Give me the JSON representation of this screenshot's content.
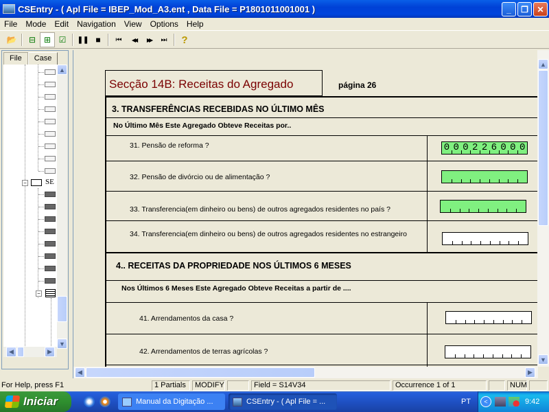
{
  "window": {
    "title": "CSEntry - ( Apl File = IBEP_Mod_A3.ent , Data File = P1801011001001 )",
    "controls": [
      "minimize",
      "restore",
      "close"
    ]
  },
  "menu": [
    "File",
    "Mode",
    "Edit",
    "Navigation",
    "View",
    "Options",
    "Help"
  ],
  "toolbar": {
    "icons": [
      "open-folder-icon",
      "add-case-icon",
      "insert-node-icon",
      "verify-icon",
      "pause-icon",
      "stop-icon",
      "first-icon",
      "previous-icon",
      "next-icon",
      "last-icon",
      "help-icon"
    ],
    "glyphs": [
      "📂",
      "⊟",
      "⊞",
      "☑",
      "❚❚",
      "■",
      "⏮",
      "◀◀",
      "▶▶",
      "⏭",
      "?"
    ]
  },
  "tree": {
    "tabs": [
      "File",
      "Case"
    ],
    "active_tab": "Case",
    "node_label": "SE"
  },
  "form": {
    "title": "Secção 14B:  Receitas do Agregado",
    "page_label": "página 26",
    "sections": [
      {
        "heading": "3. TRANSFERÊNCIAS RECEBIDAS NO ÚLTIMO MÊS",
        "subheading": "No Último Mês  Este Agregado Obteve Receitas por..",
        "questions": [
          {
            "label": "31. Pensão de reforma ?",
            "value": "000226000",
            "state": "filled"
          },
          {
            "label": "32. Pensão de divórcio ou de alimentação ?",
            "value": "",
            "state": "filled"
          },
          {
            "label": "33. Transferencia(em dinheiro ou bens) de outros agregados residentes no país ?",
            "value": "",
            "state": "current"
          },
          {
            "label": "34. Transferencia(em dinheiro ou bens) de outros agregados residentes no estrangeiro",
            "value": "",
            "state": "empty"
          }
        ]
      },
      {
        "heading": "4.. RECEITAS DA PROPRIEDADE NOS ÚLTIMOS 6 MESES",
        "subheading": "Nos Últimos 6 Meses  Este Agregado Obteve Receitas a partir de ....",
        "questions": [
          {
            "label": "41. Arrendamentos da casa ?",
            "value": "",
            "state": "empty"
          },
          {
            "label": "42. Arrendamentos de terras agrícolas ?",
            "value": "",
            "state": "empty"
          }
        ]
      }
    ],
    "colors": {
      "filled_field": "#80f080",
      "empty_field": "#ffffff",
      "title": "#7a0000"
    }
  },
  "statusbar": {
    "help": "For Help, press F1",
    "partials": "1 Partials",
    "mode": "MODIFY",
    "field": "Field = S14V34",
    "occurrence": "Occurrence 1 of 1",
    "num": "NUM"
  },
  "taskbar": {
    "start_label": "Iniciar",
    "tasks": [
      "Manual da Digitação ...",
      "CSEntry - ( Apl File = ..."
    ],
    "language": "PT",
    "clock": "9:42"
  }
}
